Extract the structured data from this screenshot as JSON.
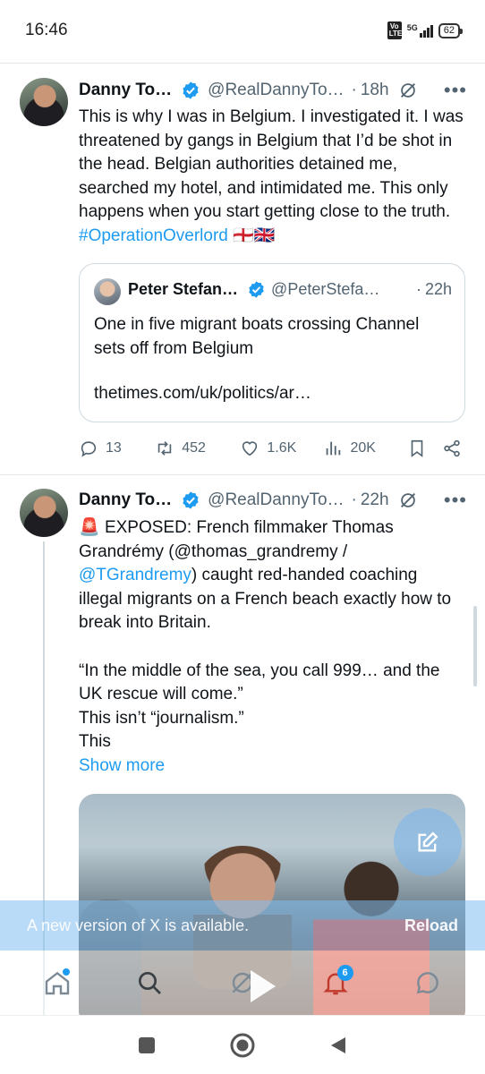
{
  "status_bar": {
    "time": "16:46",
    "volte": "Vo LTE",
    "network": "5G",
    "battery": "62"
  },
  "tweets": [
    {
      "author": "Danny To…",
      "handle": "@RealDannyTo…",
      "time_ago": "18h",
      "text_prefix": "This is why I was in Belgium. I investigated it. I was threatened by gangs in Belgium that I’d be shot in the head. Belgian authorities detained me, searched my hotel, and intimidated me. This only happens when you start getting close to the truth. ",
      "hashtag": "#OperationOverlord",
      "flags": "🏴󠁧󠁢󠁥󠁮󠁧󠁿🇬🇧",
      "quote": {
        "author": "Peter Stefan…",
        "handle": "@PeterStefa…",
        "time_ago": "22h",
        "text": "One in five migrant boats crossing Channel sets off from Belgium",
        "link": "thetimes.com/uk/politics/ar…"
      },
      "actions": {
        "replies": "13",
        "reposts": "452",
        "likes": "1.6K",
        "views": "20K"
      }
    },
    {
      "author": "Danny To…",
      "handle": "@RealDannyTo…",
      "time_ago": "22h",
      "emoji": "🚨",
      "line1": " EXPOSED: French filmmaker Thomas Grandrémy (@thomas_grandremy / ",
      "mention": "@TGrandremy",
      "line2": ") caught red-handed coaching illegal migrants on a French beach exactly how to break into Britain.",
      "quote_line": "“In the middle of the sea, you call 999… and the UK rescue will come.”",
      "line3": "This isn’t “journalism.”",
      "line4": "This",
      "show_more": "Show more"
    }
  ],
  "banner": {
    "message": "A new version of X is available.",
    "action": "Reload"
  },
  "bottom_nav": {
    "notifications_count": "6"
  },
  "colors": {
    "accent": "#1d9bf0",
    "text": "#0f1419",
    "muted": "#536471",
    "border": "#cfd9de"
  }
}
